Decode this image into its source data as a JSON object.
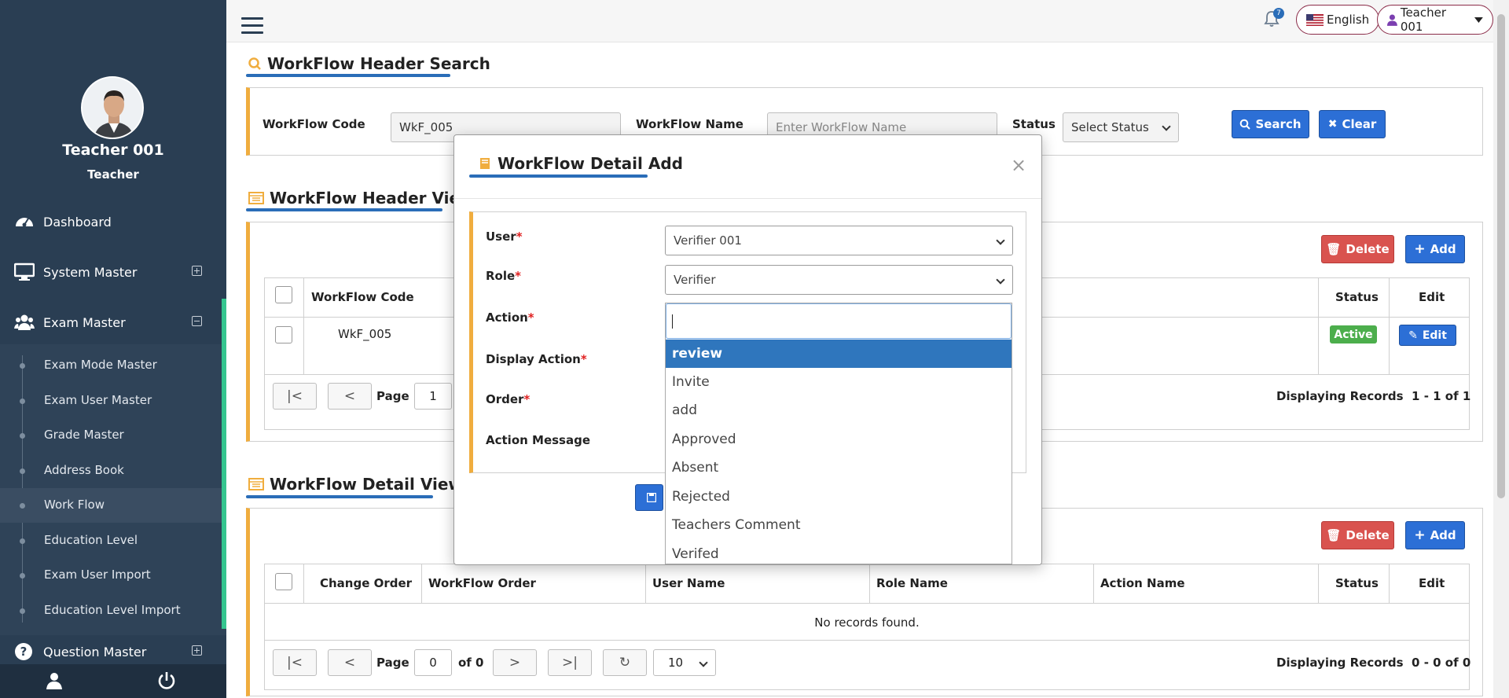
{
  "sidebar": {
    "user_name": "Teacher 001",
    "user_role": "Teacher",
    "menu": [
      {
        "label": "Dashboard",
        "icon": "dashboard-icon"
      },
      {
        "label": "System Master",
        "icon": "monitor-icon",
        "toggle": "expand"
      },
      {
        "label": "Exam Master",
        "icon": "users-icon",
        "toggle": "collapse"
      },
      {
        "label": "Question Master",
        "icon": "question-icon",
        "toggle": "expand"
      }
    ],
    "submenu": [
      "Exam Mode Master",
      "Exam User Master",
      "Grade Master",
      "Address Book",
      "Work Flow",
      "Education Level",
      "Exam User Import",
      "Education Level Import"
    ],
    "active_submenu": "Work Flow",
    "bottom": [
      "user-icon",
      "power-icon"
    ]
  },
  "topbar": {
    "notification_count": "7",
    "language": "English",
    "user": "Teacher 001"
  },
  "search": {
    "title": "WorkFlow Header Search",
    "code_label": "WorkFlow Code",
    "code_value": "WkF_005",
    "name_label": "WorkFlow Name",
    "name_placeholder": "Enter WorkFlow Name",
    "status_label": "Status",
    "status_value": "Select Status",
    "search_button": "Search",
    "clear_button": "Clear"
  },
  "header_view": {
    "title": "WorkFlow Header View",
    "delete_button": "Delete",
    "add_button": "Add",
    "columns": [
      "WorkFlow Code",
      "Status",
      "Edit"
    ],
    "rows": [
      {
        "code": "WkF_005",
        "status": "Active",
        "edit": "Edit"
      }
    ],
    "page_label": "Page",
    "page_value": "1",
    "records": "Displaying Records  1 - 1 of 1"
  },
  "detail_view": {
    "title": "WorkFlow Detail View",
    "delete_button": "Delete",
    "add_button": "Add",
    "columns": [
      "Change Order",
      "WorkFlow Order",
      "User Name",
      "Role Name",
      "Action Name",
      "Status",
      "Edit"
    ],
    "empty_text": "No records found.",
    "page_label": "Page",
    "page_value": "0",
    "of_label": "of 0",
    "page_size": "10",
    "records": "Displaying Records  0 - 0 of 0"
  },
  "modal": {
    "title": "WorkFlow Detail Add",
    "close": "×",
    "fields": {
      "user_label": "User",
      "user_value": "Verifier 001",
      "role_label": "Role",
      "role_value": "Verifier",
      "action_label": "Action",
      "display_action_label": "Display Action",
      "order_label": "Order",
      "action_message_label": "Action Message"
    },
    "required_mark": "*",
    "action_options": [
      "review",
      "Invite",
      "add",
      "Approved",
      "Absent",
      "Rejected",
      "Teachers Comment",
      "Verifed"
    ],
    "highlighted_option": "review"
  },
  "colors": {
    "sidebar": "#2a3e53",
    "accent": "#2a6db8",
    "panel_border": "#f0ad3e",
    "active_green": "#35c58f"
  }
}
